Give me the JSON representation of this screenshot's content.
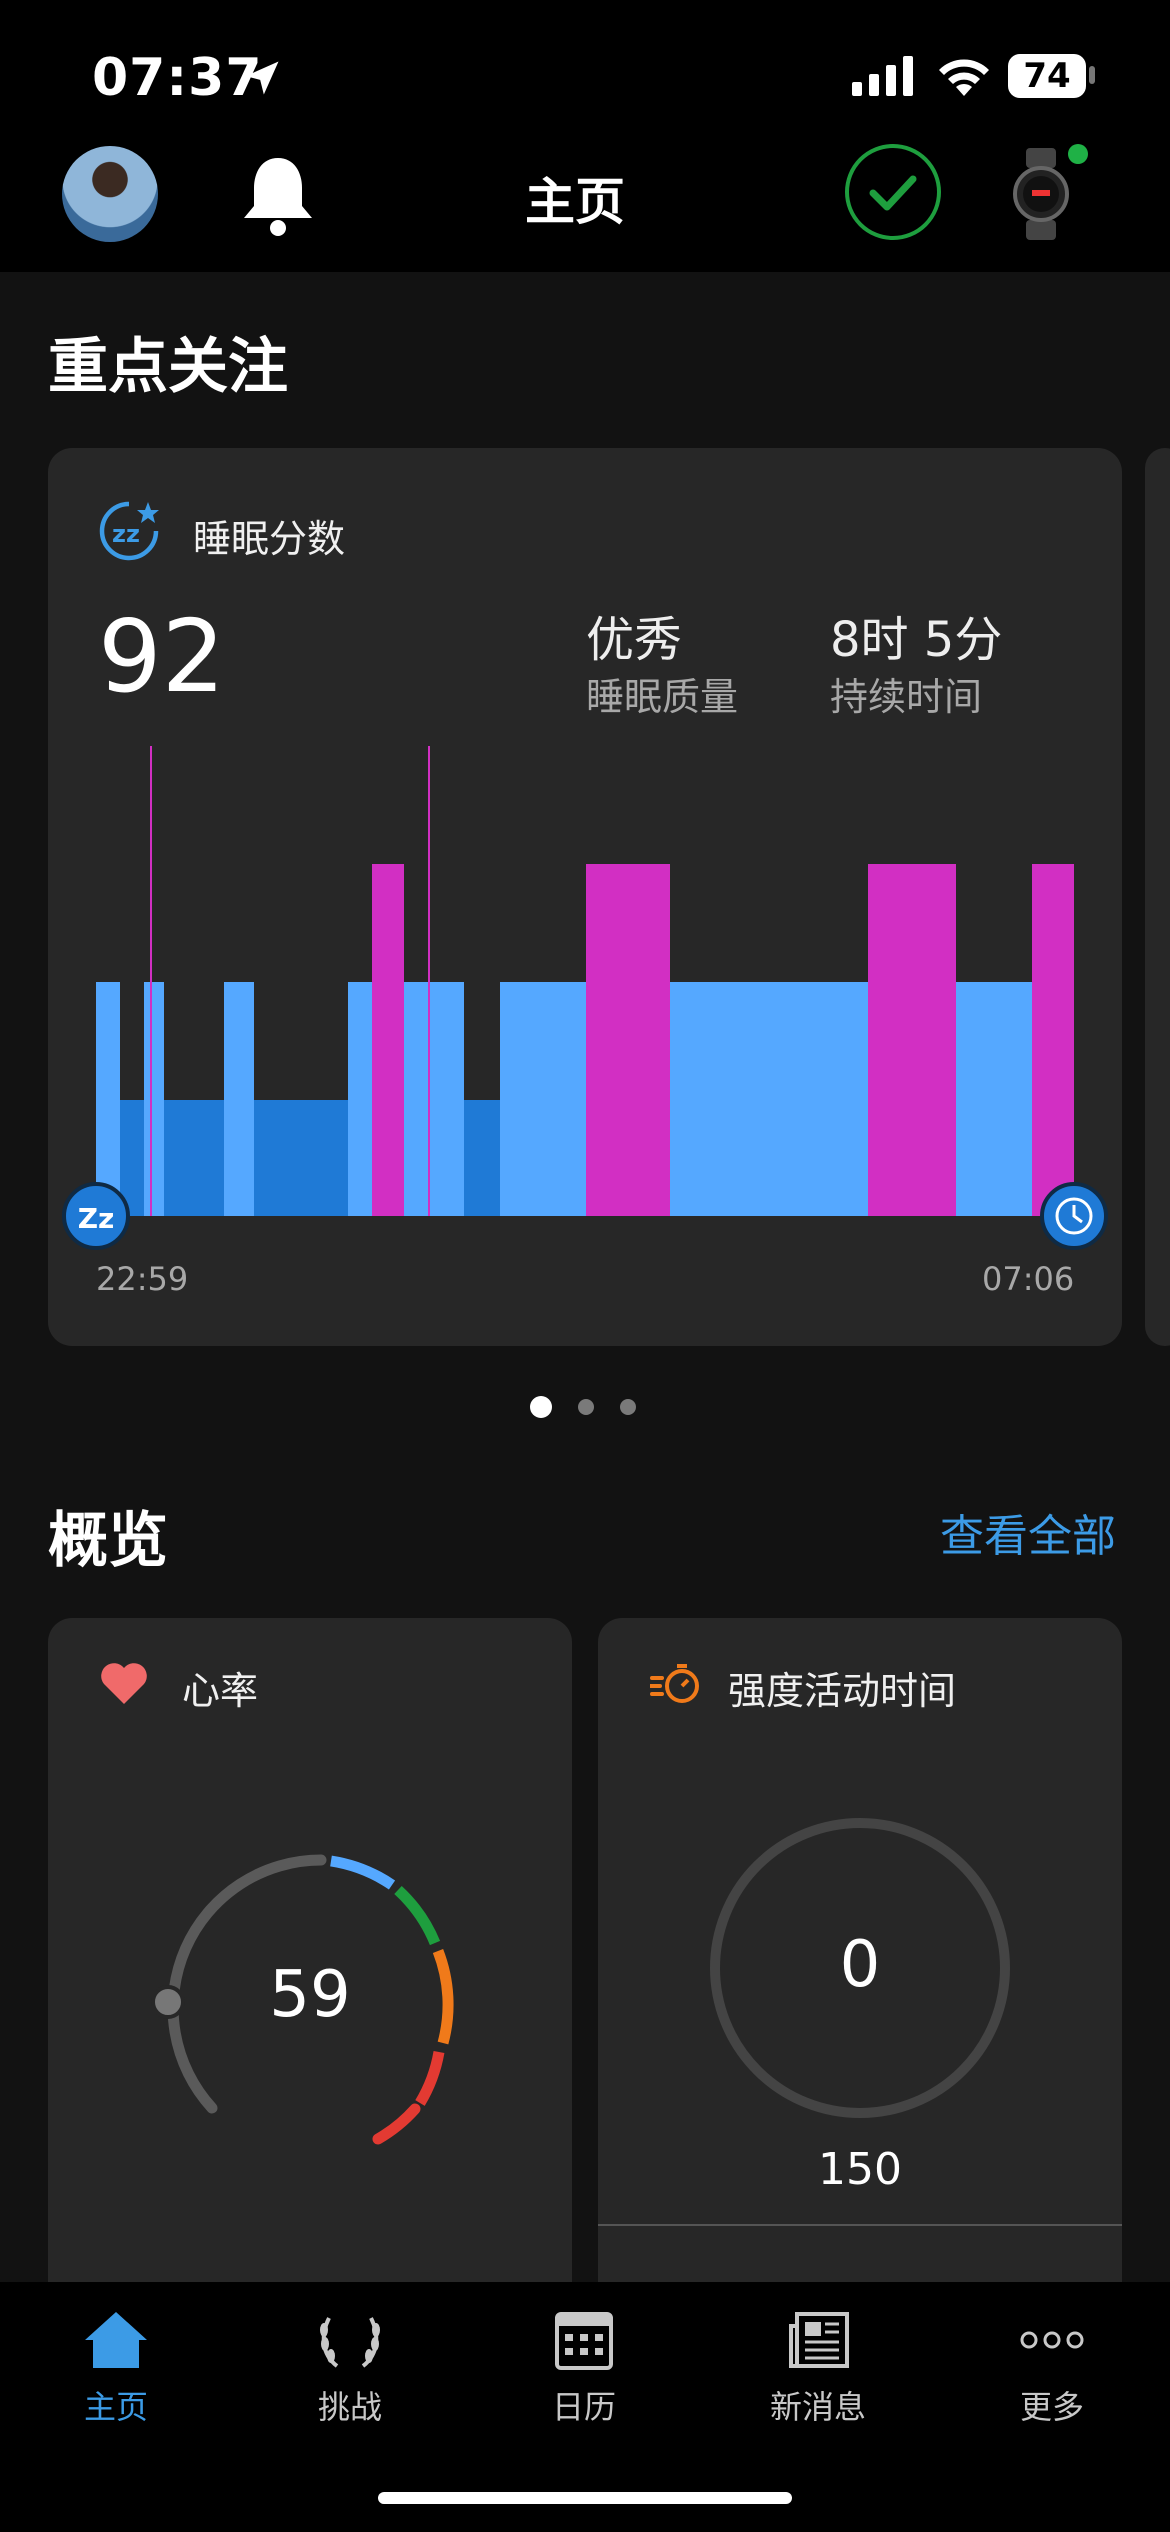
{
  "status_bar": {
    "time": "07:37",
    "battery": "74"
  },
  "nav": {
    "title": "主页"
  },
  "highlights": {
    "title": "重点关注",
    "sleep": {
      "label": "睡眠分数",
      "score": "92",
      "quality_value": "优秀",
      "quality_label": "睡眠质量",
      "duration_value": "8时 5分",
      "duration_label": "持续时间",
      "start_time": "22:59",
      "end_time": "07:06",
      "start_icon_text": "Zz",
      "stage_colors": {
        "deep": "#1f7ad6",
        "light": "#55a8ff",
        "rem": "#d22fc3"
      }
    },
    "page_dots": 3,
    "active_page": 0
  },
  "overview": {
    "title": "概览",
    "see_all": "查看全部",
    "heart_rate": {
      "label": "心率",
      "value": "59"
    },
    "intensity": {
      "label": "强度活动时间",
      "value": "0",
      "goal": "150"
    }
  },
  "tabs": [
    {
      "label": "主页",
      "icon": "home-icon",
      "active": true
    },
    {
      "label": "挑战",
      "icon": "laurel-icon",
      "active": false
    },
    {
      "label": "日历",
      "icon": "calendar-icon",
      "active": false
    },
    {
      "label": "新消息",
      "icon": "newspaper-icon",
      "active": false
    },
    {
      "label": "更多",
      "icon": "more-icon",
      "active": false
    }
  ]
}
